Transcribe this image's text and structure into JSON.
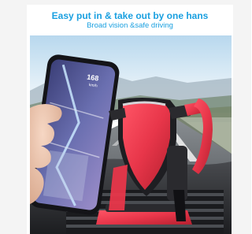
{
  "banner": {
    "headline": "Easy put in & take out by one hans",
    "subline": "Broad vision &safe driving"
  },
  "phone_screen": {
    "speed": "168",
    "speed_unit": "km/h"
  },
  "colors": {
    "accent_blue": "#1aa0e0",
    "mount_red": "#e8364a",
    "mount_dark": "#1e1e22"
  },
  "image": {
    "subject": "car-phone-mount-photo"
  }
}
